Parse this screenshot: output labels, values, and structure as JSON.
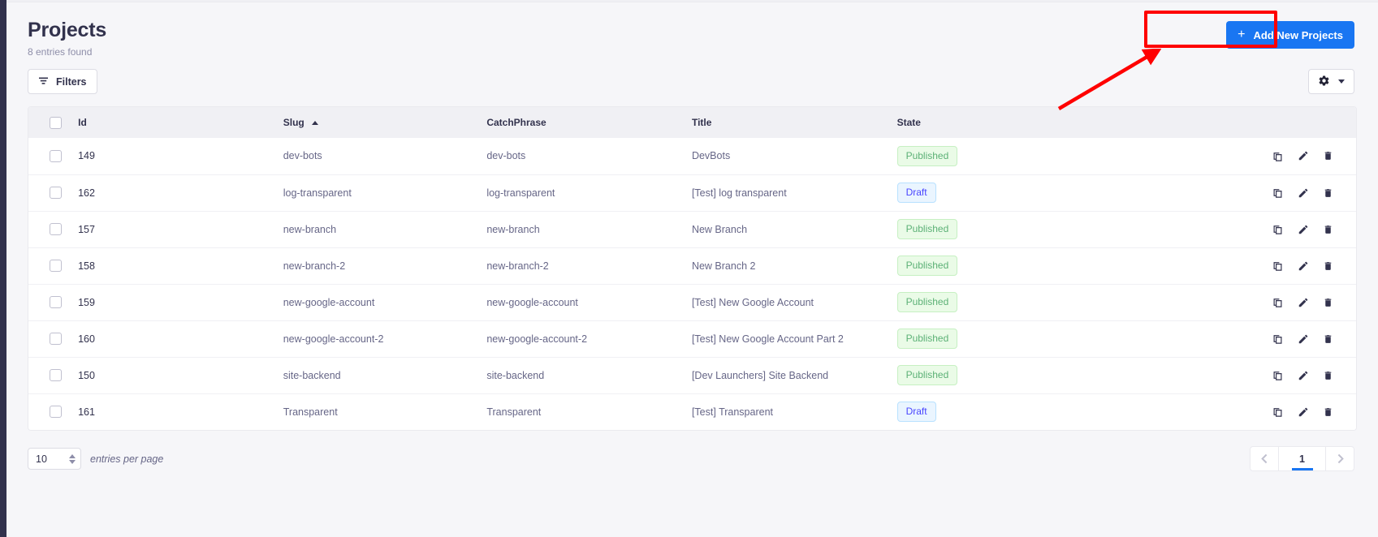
{
  "header": {
    "title": "Projects",
    "subtitle": "8 entries found",
    "add_button_label": "Add New Projects",
    "add_button_icon": "plus-icon",
    "accent_color": "#1976f2",
    "annotation_color": "#ff0000"
  },
  "toolbar": {
    "filters_label": "Filters",
    "filters_icon": "filter-icon",
    "settings_icon": "gear-icon",
    "settings_caret_icon": "chevron-down-icon"
  },
  "table": {
    "select_all_checkbox": "unchecked",
    "columns": [
      {
        "key": "id",
        "label": "Id",
        "sorted": false
      },
      {
        "key": "slug",
        "label": "Slug",
        "sorted": true,
        "sort_direction": "asc",
        "sort_icon": "caret-up-icon"
      },
      {
        "key": "catchphrase",
        "label": "CatchPhrase",
        "sorted": false
      },
      {
        "key": "title",
        "label": "Title",
        "sorted": false
      },
      {
        "key": "state",
        "label": "State",
        "sorted": false
      }
    ],
    "row_action_icons": [
      "duplicate-icon",
      "edit-pencil-icon",
      "delete-trash-icon"
    ],
    "rows": [
      {
        "id": "149",
        "slug": "dev-bots",
        "catchphrase": "dev-bots",
        "title": "DevBots",
        "state": "Published",
        "state_kind": "published"
      },
      {
        "id": "162",
        "slug": "log-transparent",
        "catchphrase": "log-transparent",
        "title": "[Test] log transparent",
        "state": "Draft",
        "state_kind": "draft"
      },
      {
        "id": "157",
        "slug": "new-branch",
        "catchphrase": "new-branch",
        "title": "New Branch",
        "state": "Published",
        "state_kind": "published"
      },
      {
        "id": "158",
        "slug": "new-branch-2",
        "catchphrase": "new-branch-2",
        "title": "New Branch 2",
        "state": "Published",
        "state_kind": "published"
      },
      {
        "id": "159",
        "slug": "new-google-account",
        "catchphrase": "new-google-account",
        "title": "[Test] New Google Account",
        "state": "Published",
        "state_kind": "published"
      },
      {
        "id": "160",
        "slug": "new-google-account-2",
        "catchphrase": "new-google-account-2",
        "title": "[Test] New Google Account Part 2",
        "state": "Published",
        "state_kind": "published"
      },
      {
        "id": "150",
        "slug": "site-backend",
        "catchphrase": "site-backend",
        "title": "[Dev Launchers] Site Backend",
        "state": "Published",
        "state_kind": "published"
      },
      {
        "id": "161",
        "slug": "Transparent",
        "catchphrase": "Transparent",
        "title": "[Test] Transparent",
        "state": "Draft",
        "state_kind": "draft"
      }
    ]
  },
  "footer": {
    "entries_per_page_value": "10",
    "entries_per_page_label": "entries per page",
    "pagination": {
      "previous_icon": "chevron-left-icon",
      "next_icon": "chevron-right-icon",
      "current_page": "1"
    }
  },
  "badge_colors": {
    "published_text": "#5cb176",
    "published_bg": "#eafbe7",
    "draft_text": "#4945ff",
    "draft_bg": "#eaf5ff"
  }
}
